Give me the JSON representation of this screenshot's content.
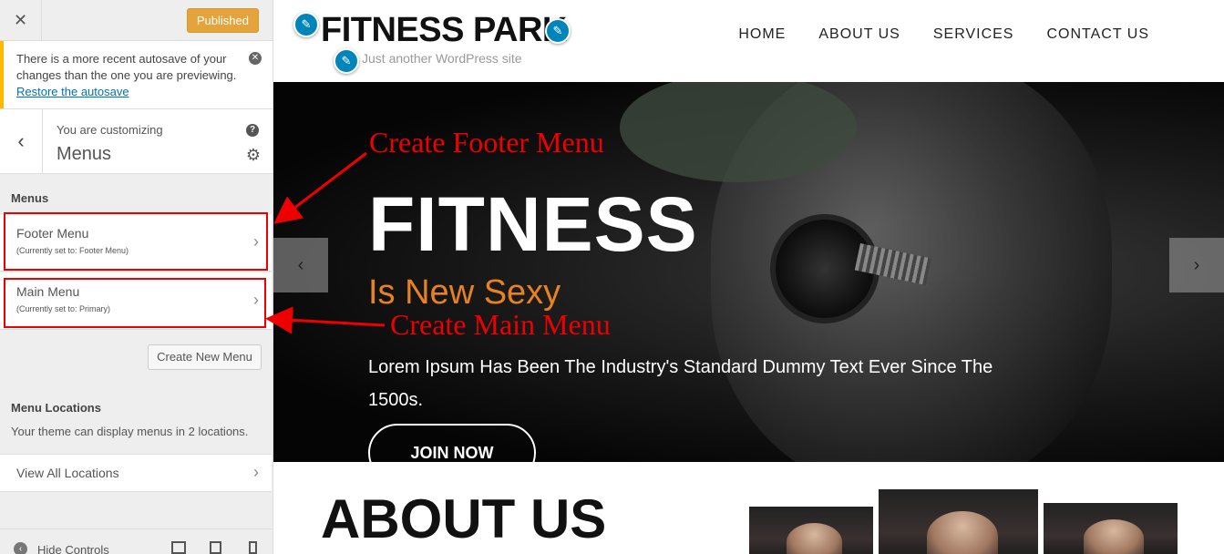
{
  "sidebar": {
    "close_icon": "close-icon",
    "publish_label": "Published",
    "notice": {
      "text": "There is a more recent autosave of your changes than the one you are previewing.",
      "link": "Restore the autosave"
    },
    "customizing_label": "You are customizing",
    "customizing_title": "Menus",
    "menus_heading": "Menus",
    "menus": [
      {
        "name": "Footer Menu",
        "sub": "(Currently set to: Footer Menu)"
      },
      {
        "name": "Main Menu",
        "sub": "(Currently set to: Primary)"
      }
    ],
    "create_menu_label": "Create New Menu",
    "locations_heading": "Menu Locations",
    "locations_desc": "Your theme can display menus in 2 locations.",
    "view_all_label": "View All Locations",
    "hide_controls_label": "Hide Controls"
  },
  "preview": {
    "site_title": "FITNESS PARK",
    "site_tagline": "Just another WordPress site",
    "nav": [
      "HOME",
      "ABOUT US",
      "SERVICES",
      "CONTACT US"
    ],
    "hero": {
      "title": "FITNESS",
      "subtitle": "Is New Sexy",
      "text": "Lorem Ipsum Has Been The Industry's Standard Dummy Text Ever Since The 1500s.",
      "button": "JOIN NOW"
    },
    "about_title": "ABOUT US"
  },
  "annotations": {
    "footer": "Create Footer Menu",
    "main": "Create Main Menu"
  },
  "colors": {
    "accent_orange": "#e8821e",
    "publish_button": "#e5a43b",
    "annotation_red": "#e00000",
    "link_blue": "#0073aa",
    "notice_border": "#ffb900"
  }
}
